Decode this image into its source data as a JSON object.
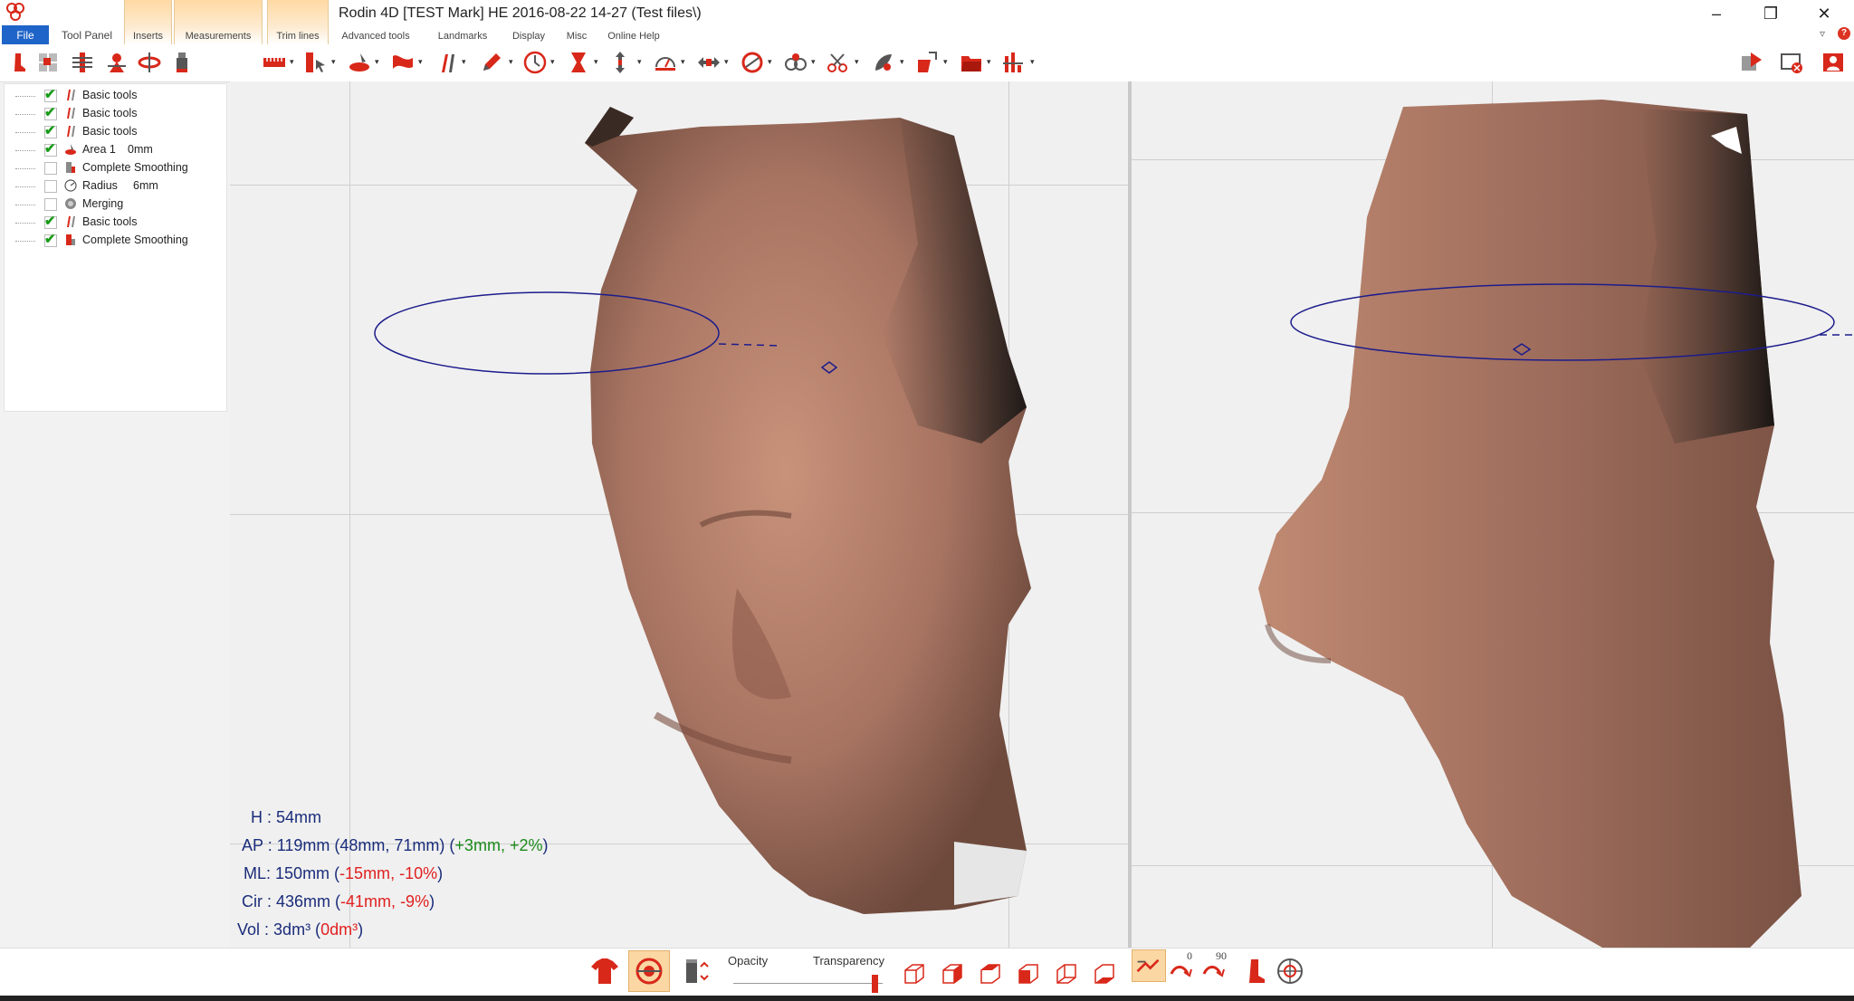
{
  "window": {
    "title": "Rodin 4D [TEST Mark] HE 2016-08-22  14-27 (Test files\\)",
    "minimize_glyph": "–",
    "maximize_glyph": "❐",
    "close_glyph": "✕"
  },
  "menu": {
    "tabs": [
      {
        "label": "File"
      },
      {
        "label": "Tool Panel"
      },
      {
        "label": "Inserts"
      },
      {
        "label": "Measurements"
      },
      {
        "label": "Trim lines"
      },
      {
        "label": "Advanced tools"
      },
      {
        "label": "Landmarks"
      },
      {
        "label": "Display"
      },
      {
        "label": "Misc"
      },
      {
        "label": "Online Help"
      }
    ]
  },
  "toolbar_icons": [
    "foot-icon",
    "grid-icon",
    "plane-icon",
    "figure-icon",
    "section-icon",
    "cylinder-icon",
    "ruler-icon",
    "cursor-icon",
    "scanner-icon",
    "sculpt-icon",
    "tools-icon",
    "pencil-icon",
    "target-icon",
    "width-icon",
    "height-icon",
    "gauge-icon",
    "arrows-icon",
    "circle-icon",
    "rings-icon",
    "scissors-icon",
    "landmark-icon",
    "export-icon",
    "folder-icon",
    "bars-icon",
    "user-delete-icon",
    "close-window-icon",
    "user-icon"
  ],
  "tree": {
    "items": [
      {
        "label": "Basic tools",
        "checked": true,
        "value": ""
      },
      {
        "label": "Basic tools",
        "checked": true,
        "value": ""
      },
      {
        "label": "Basic tools",
        "checked": true,
        "value": ""
      },
      {
        "label": "Area 1",
        "checked": true,
        "value": "0mm"
      },
      {
        "label": "Complete Smoothing",
        "checked": false,
        "value": ""
      },
      {
        "label": "Radius",
        "checked": false,
        "value": "6mm"
      },
      {
        "label": "Merging",
        "checked": false,
        "value": ""
      },
      {
        "label": "Basic tools",
        "checked": true,
        "value": ""
      },
      {
        "label": "Complete Smoothing",
        "checked": true,
        "value": ""
      }
    ]
  },
  "measurements": {
    "h": {
      "label": "H :",
      "value": "54mm"
    },
    "ap": {
      "label": "AP :",
      "value": "119mm (48mm, 71mm) (",
      "delta_a": "+3mm",
      "sep": ", ",
      "delta_b": "+2%",
      "close": ")"
    },
    "ml": {
      "label": "ML:",
      "value": "150mm (",
      "delta_a": "-15mm",
      "sep": ", ",
      "delta_b": "-10%",
      "close": ")"
    },
    "cir": {
      "label": "Cir :",
      "value": "436mm (",
      "delta_a": "-41mm",
      "sep": ", ",
      "delta_b": "-9%",
      "close": ")"
    },
    "vol": {
      "label": "Vol :",
      "value": "3dm³ (",
      "delta": "0dm³",
      "close": ")"
    }
  },
  "bottom": {
    "opacity_label": "Opacity",
    "transparency_label": "Transparency",
    "transparency_level": 0.95,
    "rotate_label_0": "0",
    "rotate_label_90": "90"
  },
  "colors": {
    "accent": "#d8281a",
    "file_tab": "#1f64c8",
    "highlight_tab": "#fdd9a4",
    "measurement_text": "#1a2c7a",
    "positive": "#1a8a1a",
    "negative": "#e02020",
    "circumference_line": "#1c1c8c"
  }
}
